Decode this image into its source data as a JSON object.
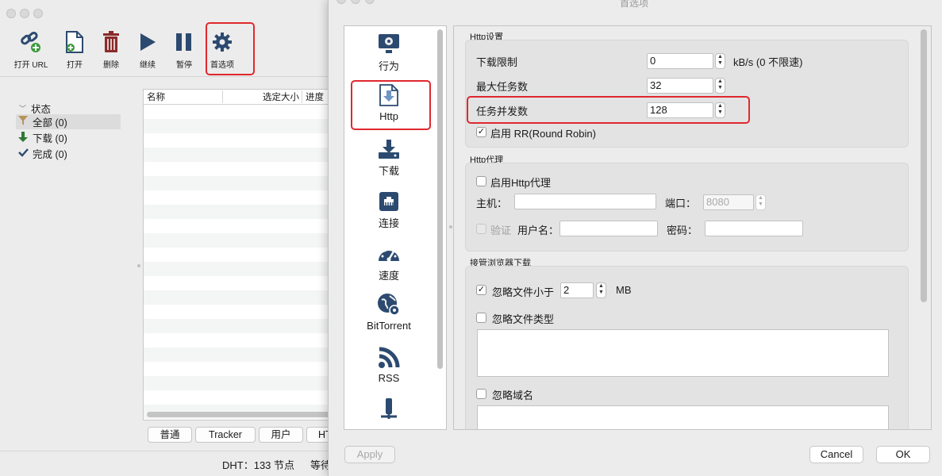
{
  "main": {
    "toolbar": [
      {
        "label": "打开 URL",
        "icon": "open-url-icon"
      },
      {
        "label": "打开",
        "icon": "open-file-icon"
      },
      {
        "label": "删除",
        "icon": "trash-icon"
      },
      {
        "label": "继续",
        "icon": "play-icon"
      },
      {
        "label": "暂停",
        "icon": "pause-icon"
      },
      {
        "label": "首选项",
        "icon": "gear-icon"
      }
    ],
    "sidebar": {
      "header": "状态",
      "items": [
        {
          "label": "全部 (0)",
          "icon": "filter-icon"
        },
        {
          "label": "下载 (0)",
          "icon": "down-arrow-icon"
        },
        {
          "label": "完成 (0)",
          "icon": "check-icon"
        }
      ]
    },
    "list": {
      "columns": [
        "名称",
        "选定大小",
        "进度"
      ]
    },
    "tabs": [
      "普通",
      "Tracker",
      "用户",
      "HT"
    ],
    "status": {
      "dht": "DHT：133 节点",
      "waiting": "等待"
    }
  },
  "dialog": {
    "title": "首选项",
    "categories": [
      "行为",
      "Http",
      "下载",
      "连接",
      "速度",
      "BitTorrent",
      "RSS",
      "..."
    ],
    "http_settings": {
      "title": "Http设置",
      "speed_limit_label": "下载限制",
      "speed_limit_value": "0",
      "speed_limit_unit": "kB/s (0 不限速)",
      "max_tasks_label": "最大任务数",
      "max_tasks_value": "32",
      "concurrency_label": "任务并发数",
      "concurrency_value": "128",
      "round_robin_label": "启用 RR(Round Robin)"
    },
    "http_proxy": {
      "title": "Http代理",
      "enable_label": "启用Http代理",
      "host_label": "主机：",
      "host_value": "",
      "port_label": "端口：",
      "port_value": "8080",
      "auth_label": "验证",
      "username_label": "用户名：",
      "username_value": "",
      "password_label": "密码：",
      "password_value": ""
    },
    "browser": {
      "title": "接管浏览器下载",
      "ignore_size_label": "忽略文件小于",
      "ignore_size_value": "2",
      "ignore_size_unit": "MB",
      "ignore_types_label": "忽略文件类型",
      "ignore_domains_label": "忽略域名"
    },
    "buttons": {
      "apply": "Apply",
      "cancel": "Cancel",
      "ok": "OK"
    }
  },
  "colors": {
    "highlight_red": "#e0282e",
    "icon_blue": "#2c4a70"
  }
}
